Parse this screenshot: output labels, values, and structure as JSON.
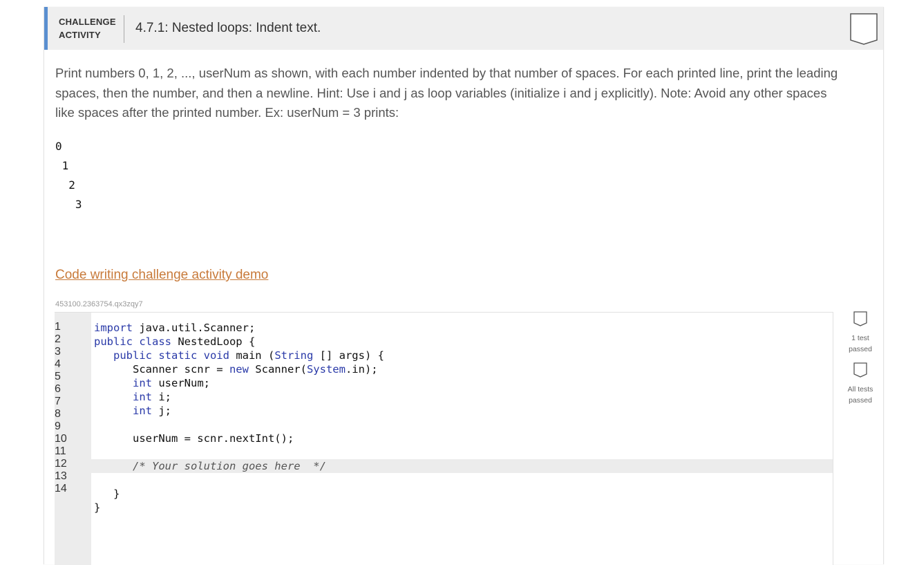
{
  "header": {
    "label_line1": "CHALLENGE",
    "label_line2": "ACTIVITY",
    "title": "4.7.1: Nested loops: Indent text."
  },
  "description": "Print numbers 0, 1, 2, ..., userNum as shown, with each number indented by that number of spaces. For each printed line, print the leading spaces, then the number, and then a newline. Hint: Use i and j as loop variables (initialize i and j explicitly). Note: Avoid any other spaces like spaces after the printed number. Ex: userNum = 3 prints:",
  "example_output": [
    "0",
    " 1",
    "  2",
    "   3"
  ],
  "demo_link": "Code writing challenge activity demo",
  "code_id": "453100.2363754.qx3zqy7",
  "editor": {
    "line_numbers": [
      "1",
      "2",
      "3",
      "4",
      "5",
      "6",
      "7",
      "8",
      "9",
      "10",
      "11",
      "12",
      "13",
      "14"
    ],
    "active_line": 11
  },
  "side_status": {
    "test1_label_1": "1 test",
    "test1_label_2": "passed",
    "test2_label_1": "All tests",
    "test2_label_2": "passed"
  },
  "colors": {
    "accent": "#5a8fd0",
    "link": "#c87a3a",
    "keyword": "#2a3aa8"
  }
}
